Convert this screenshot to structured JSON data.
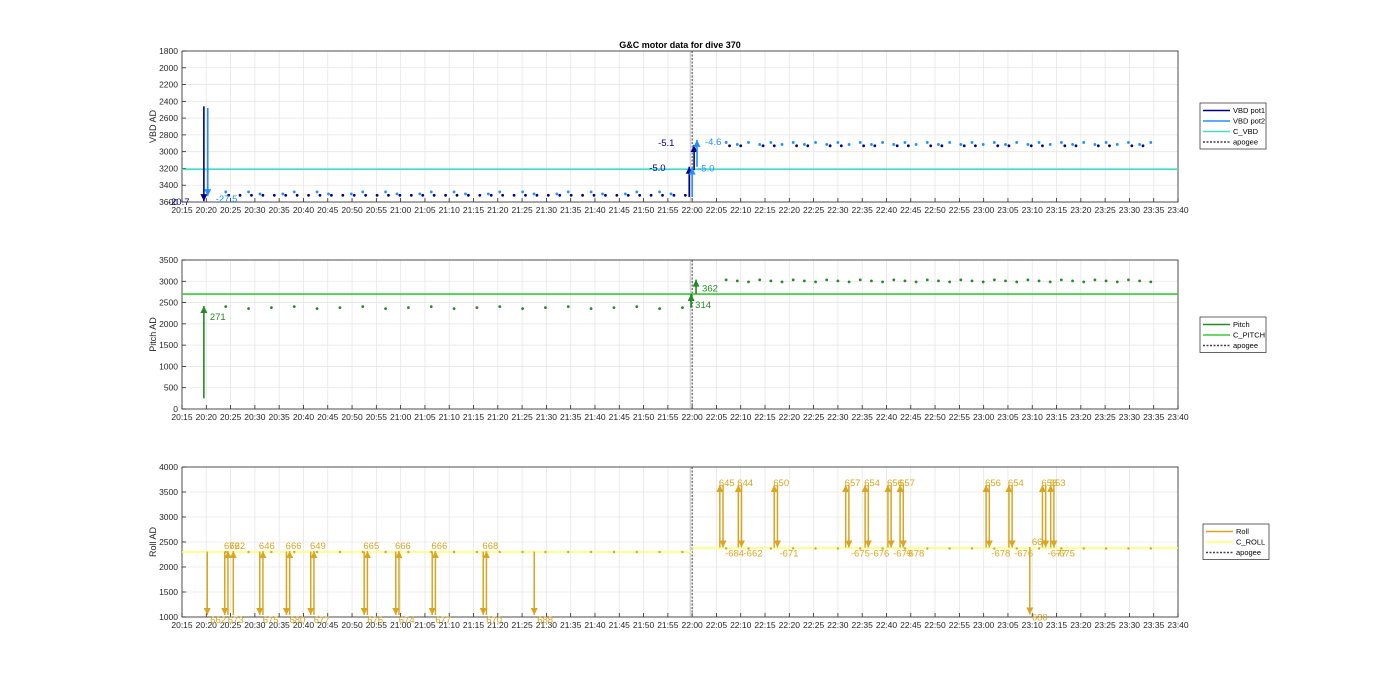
{
  "colors": {
    "vbd_pot1": "#00008b",
    "vbd_pot2": "#1e90ff",
    "c_vbd": "#40e0d0",
    "pitch": "#228b22",
    "c_pitch": "#32cd32",
    "roll": "#daa520",
    "c_roll": "#ffff66",
    "apogee": "#404040",
    "grid": "#e6e6e6"
  },
  "chart_data": [
    {
      "type": "scatter",
      "title": "G&C motor data for dive 370",
      "ylabel": "VBD AD",
      "xlim": [
        "20:15",
        "23:40"
      ],
      "ylim": [
        1800,
        3600
      ],
      "y_reversed": true,
      "x_ticks": [
        "20:15",
        "20:20",
        "20:25",
        "20:30",
        "20:35",
        "20:40",
        "20:45",
        "20:50",
        "20:55",
        "21:00",
        "21:05",
        "21:10",
        "21:15",
        "21:20",
        "21:25",
        "21:30",
        "21:35",
        "21:40",
        "21:45",
        "21:50",
        "21:55",
        "22:00",
        "22:05",
        "22:10",
        "22:15",
        "22:20",
        "22:25",
        "22:30",
        "22:35",
        "22:40",
        "22:45",
        "22:50",
        "22:55",
        "23:00",
        "23:05",
        "23:10",
        "23:15",
        "23:20",
        "23:25",
        "23:30",
        "23:35",
        "23:40"
      ],
      "y_ticks": [
        "1800",
        "2000",
        "2200",
        "2400",
        "2600",
        "2800",
        "3000",
        "3200",
        "3400",
        "3600"
      ],
      "legend_position": "right",
      "legend": [
        "VBD pot1",
        "VBD pot2",
        "C_VBD",
        "apogee"
      ],
      "series": [
        {
          "name": "VBD pot1",
          "dive_level": 3520,
          "climb_level": 2930
        },
        {
          "name": "VBD pot2",
          "dive_level": 3480,
          "climb_level": 2890
        },
        {
          "name": "C_VBD",
          "value": 3210
        }
      ],
      "apogee": "22:00",
      "arrows": [
        {
          "time": "20:19.5",
          "from": 2460,
          "to": 3590,
          "label": "-20.7",
          "series": "VBD pot1"
        },
        {
          "time": "20:20.3",
          "from": 2480,
          "to": 3530,
          "label": "-27.5",
          "series": "VBD pot2"
        },
        {
          "time": "21:59.4",
          "from": 3540,
          "to": 3180,
          "label": "-5.0",
          "series": "VBD pot1"
        },
        {
          "time": "22:00.4",
          "from": 3220,
          "to": 2920,
          "label": "-5.1",
          "series": "VBD pot1"
        },
        {
          "time": "22:00.0",
          "from": 3540,
          "to": 3190,
          "label": "-5.0",
          "series": "VBD pot2"
        },
        {
          "time": "22:01.0",
          "from": 3180,
          "to": 2860,
          "label": "-4.6",
          "series": "VBD pot2"
        }
      ]
    },
    {
      "type": "scatter",
      "ylabel": "Pitch AD",
      "xlim": [
        "20:15",
        "23:40"
      ],
      "ylim": [
        0,
        3500
      ],
      "x_ticks": [
        "20:15",
        "20:20",
        "20:25",
        "20:30",
        "20:35",
        "20:40",
        "20:45",
        "20:50",
        "20:55",
        "21:00",
        "21:05",
        "21:10",
        "21:15",
        "21:20",
        "21:25",
        "21:30",
        "21:35",
        "21:40",
        "21:45",
        "21:50",
        "21:55",
        "22:00",
        "22:05",
        "22:10",
        "22:15",
        "22:20",
        "22:25",
        "22:30",
        "22:35",
        "22:40",
        "22:45",
        "22:50",
        "22:55",
        "23:00",
        "23:05",
        "23:10",
        "23:15",
        "23:20",
        "23:25",
        "23:30",
        "23:35",
        "23:40"
      ],
      "y_ticks": [
        "0",
        "500",
        "1000",
        "1500",
        "2000",
        "2500",
        "3000",
        "3500"
      ],
      "legend_position": "right",
      "legend": [
        "Pitch",
        "C_PITCH",
        "apogee"
      ],
      "series": [
        {
          "name": "Pitch",
          "dive_level": 2380,
          "climb_level": 3010
        },
        {
          "name": "C_PITCH",
          "value": 2700
        }
      ],
      "apogee": "22:00",
      "arrows": [
        {
          "time": "20:19.5",
          "from": 250,
          "to": 2420,
          "label": "271"
        },
        {
          "time": "21:59.8",
          "from": 2380,
          "to": 2700,
          "label": "314"
        },
        {
          "time": "22:00.8",
          "from": 2700,
          "to": 3040,
          "label": "362"
        }
      ]
    },
    {
      "type": "scatter",
      "ylabel": "Roll AD",
      "xlim": [
        "20:15",
        "23:40"
      ],
      "ylim": [
        1000,
        4000
      ],
      "x_ticks": [
        "20:15",
        "20:20",
        "20:25",
        "20:30",
        "20:35",
        "20:40",
        "20:45",
        "20:50",
        "20:55",
        "21:00",
        "21:05",
        "21:10",
        "21:15",
        "21:20",
        "21:25",
        "21:30",
        "21:35",
        "21:40",
        "21:45",
        "21:50",
        "21:55",
        "22:00",
        "22:05",
        "22:10",
        "22:15",
        "22:20",
        "22:25",
        "22:30",
        "22:35",
        "22:40",
        "22:45",
        "22:50",
        "22:55",
        "23:00",
        "23:05",
        "23:10",
        "23:15",
        "23:20",
        "23:25",
        "23:30",
        "23:35",
        "23:40"
      ],
      "y_ticks": [
        "1000",
        "1500",
        "2000",
        "2500",
        "3000",
        "3500",
        "4000"
      ],
      "legend_position": "right",
      "legend": [
        "Roll",
        "C_ROLL",
        "apogee"
      ],
      "series": [
        {
          "name": "Roll",
          "dive_level": 2300,
          "climb_level": 2370
        },
        {
          "name": "C_ROLL",
          "dive_value": 2300,
          "climb_value": 2380
        }
      ],
      "apogee": "22:00",
      "down_up_pairs": [
        {
          "time": "20:20.2",
          "down": "662",
          "up": null
        },
        {
          "time": "20:23.8",
          "down": "673",
          "up": "672"
        },
        {
          "time": "20:24.9",
          "down": null,
          "up": "662"
        },
        {
          "time": "20:31.0",
          "down": "675",
          "up": "646"
        },
        {
          "time": "20:36.5",
          "down": "680",
          "up": "666"
        },
        {
          "time": "20:41.5",
          "down": "677",
          "up": "649"
        },
        {
          "time": "20:52.5",
          "down": "676",
          "up": "665"
        },
        {
          "time": "20:59.0",
          "down": "674",
          "up": "666"
        },
        {
          "time": "21:06.5",
          "down": "677",
          "up": "666"
        },
        {
          "time": "21:17.0",
          "down": "670",
          "up": "668"
        },
        {
          "time": "21:27.5",
          "down": "688",
          "up": null
        }
      ],
      "up_down_pairs": [
        {
          "time": "22:05.7",
          "up": "645",
          "down": "-684"
        },
        {
          "time": "22:09.5",
          "up": "644",
          "down": "-662"
        },
        {
          "time": "22:16.9",
          "up": "650",
          "down": "-671"
        },
        {
          "time": "22:31.6",
          "up": "657",
          "down": "-675"
        },
        {
          "time": "22:35.6",
          "up": "654",
          "down": "-676"
        },
        {
          "time": "22:40.3",
          "up": "656",
          "down": "-679"
        },
        {
          "time": "22:42.8",
          "up": "657",
          "down": "-678"
        },
        {
          "time": "23:00.5",
          "up": "656",
          "down": "-678"
        },
        {
          "time": "23:05.2",
          "up": "654",
          "down": "-676"
        },
        {
          "time": "23:12.1",
          "up": "658",
          "down": "-677"
        },
        {
          "time": "23:13.8",
          "up": "653",
          "down": "-675"
        }
      ],
      "extra_arrow": {
        "time": "23:09.5",
        "from": 2400,
        "to": 1050,
        "labels": [
          "664",
          "680"
        ]
      }
    }
  ]
}
